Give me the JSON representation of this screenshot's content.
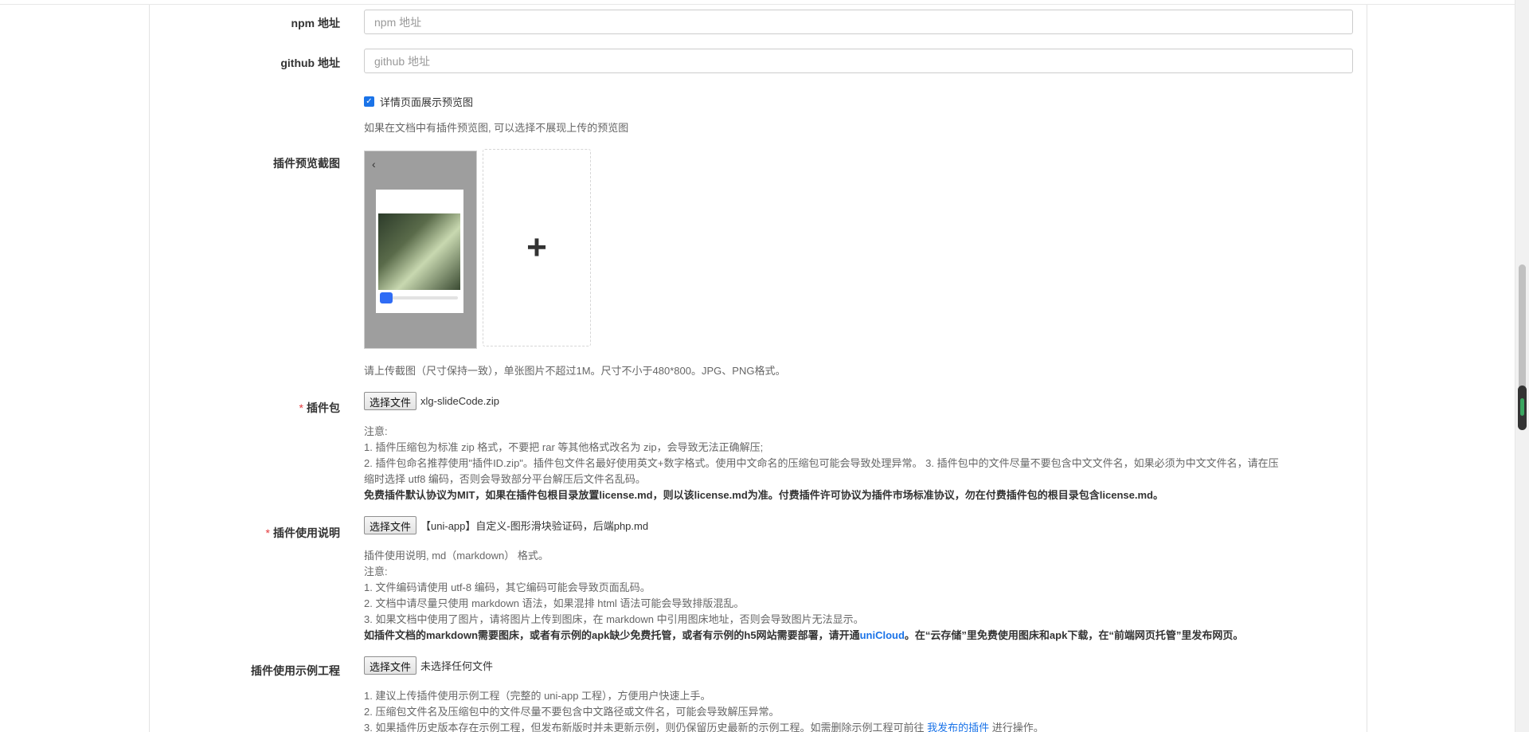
{
  "npm": {
    "label": "npm 地址",
    "placeholder": "npm 地址"
  },
  "github": {
    "label": "github 地址",
    "placeholder": "github 地址"
  },
  "preview_toggle": {
    "label": "详情页面展示预览图",
    "checked": true,
    "help": "如果在文档中有插件预览图, 可以选择不展现上传的预览图"
  },
  "screenshots": {
    "label": "插件预览截图",
    "help": "请上传截图（尺寸保持一致），单张图片不超过1M。尺寸不小于480*800。JPG、PNG格式。"
  },
  "package": {
    "required_mark": "*",
    "label": "插件包",
    "button": "选择文件",
    "file_name": "xlg-slideCode.zip",
    "notes": [
      "注意:",
      "1. 插件压缩包为标准 zip 格式，不要把 rar 等其他格式改名为 zip，会导致无法正确解压;",
      "2. 插件包命名推荐使用\"插件ID.zip\"。插件包文件名最好使用英文+数字格式。使用中文命名的压缩包可能会导致处理异常。 3. 插件包中的文件尽量不要包含中文文件名，如果必须为中文文件名，请在压",
      "缩时选择 utf8 编码，否则会导致部分平台解压后文件名乱码。"
    ],
    "bold_note": "免费插件默认协议为MIT，如果在插件包根目录放置license.md，则以该license.md为准。付费插件许可协议为插件市场标准协议，勿在付费插件包的根目录包含license.md。"
  },
  "readme": {
    "required_mark": "*",
    "label": "插件使用说明",
    "button": "选择文件",
    "file_name": "【uni-app】自定义-图形滑块验证码，后端php.md",
    "notes": [
      "插件使用说明, md（markdown） 格式。",
      "注意:",
      "1. 文件编码请使用 utf-8 编码，其它编码可能会导致页面乱码。",
      "2. 文档中请尽量只使用 markdown 语法，如果混排 html 语法可能会导致排版混乱。",
      "3. 如果文档中使用了图片，请将图片上传到图床，在 markdown 中引用图床地址，否则会导致图片无法显示。"
    ],
    "bold_note_before": "如插件文档的markdown需要图床，或者有示例的apk缺少免费托管，或者有示例的h5网站需要部署，请开通",
    "bold_note_link": "uniCloud",
    "bold_note_after": "。在“云存储”里免费使用图床和apk下载，在“前端网页托管”里发布网页。"
  },
  "example": {
    "label": "插件使用示例工程",
    "button": "选择文件",
    "file_name": "未选择任何文件",
    "notes": [
      "1. 建议上传插件使用示例工程（完整的 uni-app 工程），方便用户快速上手。",
      "2. 压缩包文件名及压缩包中的文件尽量不要包含中文路径或文件名，可能会导致解压异常。"
    ],
    "note3_before": "3. 如果插件历史版本存在示例工程，但发布新版时并未更新示例，则仍保留历史最新的示例工程。如需删除示例工程可前往 ",
    "note3_link": "我发布的插件",
    "note3_after": " 进行操作。"
  }
}
